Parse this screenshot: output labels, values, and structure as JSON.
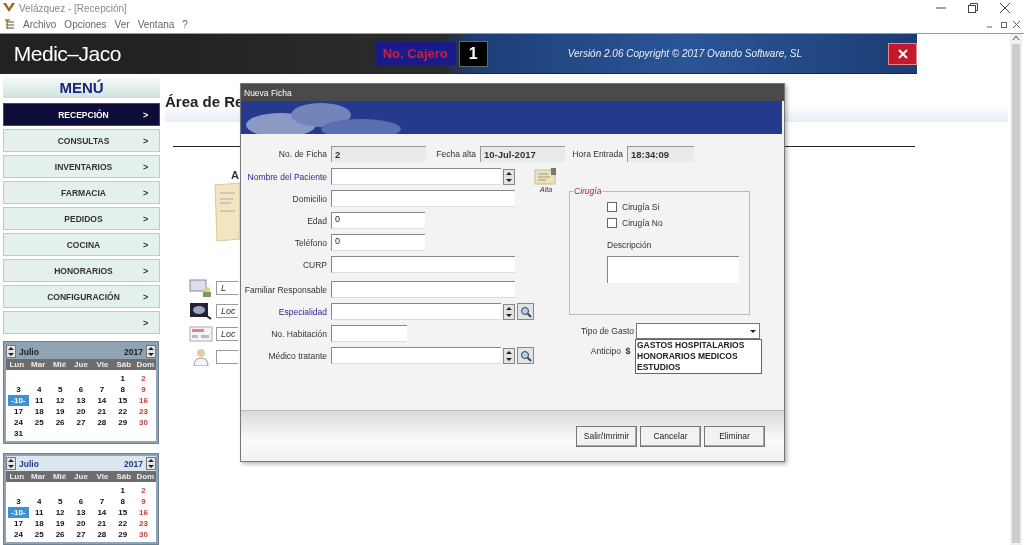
{
  "window": {
    "title": "Velázquez - [Recepción]"
  },
  "menu_bar": [
    "Archivo",
    "Opciones",
    "Ver",
    "Ventana",
    "?"
  ],
  "header": {
    "logo": "Medic–Jaco",
    "cashier_label": "No. Cajero",
    "cashier_number": "1",
    "version": "Versión 2.06 Copyright © 2017 Ovando Software, SL"
  },
  "sidebar": {
    "title": "MENÚ",
    "items": [
      {
        "label": "RECEPCIÓN",
        "arrow": ">",
        "selected": true
      },
      {
        "label": "CONSULTAS",
        "arrow": ">",
        "selected": false
      },
      {
        "label": "INVENTARIOS",
        "arrow": ">",
        "selected": false
      },
      {
        "label": "FARMACIA",
        "arrow": ">",
        "selected": false
      },
      {
        "label": "PEDIDOS",
        "arrow": ">",
        "selected": false
      },
      {
        "label": "COCINA",
        "arrow": ">",
        "selected": false
      },
      {
        "label": "HONORARIOS",
        "arrow": ">",
        "selected": false
      },
      {
        "label": "CONFIGURACIÓN",
        "arrow": ">",
        "selected": false
      },
      {
        "arrow": ">",
        "selected": false
      }
    ]
  },
  "calendars": [
    {
      "month": "Julio",
      "year": "2017",
      "weekdays": [
        "Lun",
        "Mar",
        "Mié",
        "Jue",
        "Vie",
        "Sáb",
        "Dom"
      ],
      "weeks": [
        [
          {
            "day": "1",
            "selected": false
          },
          {
            "day": "2",
            "selected": false
          }
        ],
        [
          {
            "day": "3",
            "selected": false
          },
          {
            "day": "4",
            "selected": false
          },
          {
            "day": "5",
            "selected": false
          },
          {
            "day": "6",
            "selected": false
          },
          {
            "day": "7",
            "selected": false
          },
          {
            "day": "8",
            "selected": false
          },
          {
            "day": "9",
            "selected": false
          }
        ],
        [
          {
            "day": "-10-",
            "selected": true
          },
          {
            "day": "11",
            "selected": false
          },
          {
            "day": "12",
            "selected": false
          },
          {
            "day": "13",
            "selected": false
          },
          {
            "day": "14",
            "selected": false
          },
          {
            "day": "15",
            "selected": false
          },
          {
            "day": "16",
            "selected": false
          }
        ],
        [
          {
            "day": "17",
            "selected": false
          },
          {
            "day": "18",
            "selected": false
          },
          {
            "day": "19",
            "selected": false
          },
          {
            "day": "20",
            "selected": false
          },
          {
            "day": "21",
            "selected": false
          },
          {
            "day": "22",
            "selected": false
          },
          {
            "day": "23",
            "selected": false
          }
        ],
        [
          {
            "day": "24",
            "selected": false
          },
          {
            "day": "25",
            "selected": false
          },
          {
            "day": "26",
            "selected": false
          },
          {
            "day": "27",
            "selected": false
          },
          {
            "day": "28",
            "selected": false
          },
          {
            "day": "29",
            "selected": false
          },
          {
            "day": "30",
            "selected": false
          }
        ],
        [
          {
            "day": "31",
            "selected": false
          }
        ]
      ]
    },
    {
      "month": "Julio",
      "year": "2017",
      "weekdays": [
        "Lun",
        "Mar",
        "Mié",
        "Jue",
        "Vie",
        "Sáb",
        "Dom"
      ],
      "weeks": [
        [
          {
            "day": "1",
            "selected": false
          },
          {
            "day": "2",
            "selected": false
          }
        ],
        [
          {
            "day": "3",
            "selected": false
          },
          {
            "day": "4",
            "selected": false
          },
          {
            "day": "5",
            "selected": false
          },
          {
            "day": "6",
            "selected": false
          },
          {
            "day": "7",
            "selected": false
          },
          {
            "day": "8",
            "selected": false
          },
          {
            "day": "9",
            "selected": false
          }
        ],
        [
          {
            "day": "-10-",
            "selected": true
          },
          {
            "day": "11",
            "selected": false
          },
          {
            "day": "12",
            "selected": false
          },
          {
            "day": "13",
            "selected": false
          },
          {
            "day": "14",
            "selected": false
          },
          {
            "day": "15",
            "selected": false
          },
          {
            "day": "16",
            "selected": false
          }
        ],
        [
          {
            "day": "17",
            "selected": false
          },
          {
            "day": "18",
            "selected": false
          },
          {
            "day": "19",
            "selected": false
          },
          {
            "day": "20",
            "selected": false
          },
          {
            "day": "21",
            "selected": false
          },
          {
            "day": "22",
            "selected": false
          },
          {
            "day": "23",
            "selected": false
          }
        ],
        [
          {
            "day": "24",
            "selected": false
          },
          {
            "day": "25",
            "selected": false
          },
          {
            "day": "26",
            "selected": false
          },
          {
            "day": "27",
            "selected": false
          },
          {
            "day": "28",
            "selected": false
          },
          {
            "day": "29",
            "selected": false
          },
          {
            "day": "30",
            "selected": false
          }
        ]
      ]
    }
  ],
  "main": {
    "title": "Área de Re",
    "subtitle": "A",
    "shortcuts": [
      {
        "kind": "card",
        "text": "L"
      },
      {
        "kind": "monitor",
        "text": "Loc"
      },
      {
        "kind": "form",
        "text": "Loc"
      },
      {
        "kind": "doctor"
      }
    ]
  },
  "dialog": {
    "title": "Nueva Ficha",
    "info": [
      {
        "label": "No. de Ficha",
        "value": "2"
      },
      {
        "label": "Fecha alta",
        "value": "10-Jul-2017"
      },
      {
        "label": "Hora Entrada",
        "value": "18:34:09"
      }
    ],
    "sections": [
      [
        {
          "label": "Nombre del Paciente",
          "kind": "spin",
          "linked": true
        },
        {
          "label": "Domicilio",
          "kind": "text",
          "linked": false
        },
        {
          "label": "Edad",
          "kind": "number",
          "linked": false,
          "value": "0"
        },
        {
          "label": "Teléfono",
          "kind": "number",
          "linked": false,
          "value": "0"
        },
        {
          "label": "CURP",
          "kind": "text",
          "linked": false
        }
      ],
      [
        {
          "label": "Familiar Responsable",
          "kind": "text",
          "linked": false
        },
        {
          "label": "Especialidad",
          "kind": "lookup",
          "linked": true
        },
        {
          "label": "No. Habitación",
          "kind": "short",
          "linked": false
        },
        {
          "label": "Médico tratante",
          "kind": "lookup",
          "linked": false
        }
      ]
    ],
    "alta": "Alta",
    "surgery": {
      "title": "Cirugía",
      "options": [
        {
          "label": "Cirugía Si",
          "checked": false
        },
        {
          "label": "Cirugía No",
          "checked": false
        }
      ],
      "description_label": "Descripción"
    },
    "expense": {
      "label": "Tipo de Gasto",
      "open": true,
      "options": [
        "GASTOS HOSPITALARIOS",
        "HONORARIOS MEDICOS",
        "ESTUDIOS"
      ]
    },
    "advance": {
      "label": "Anticipo",
      "currency": "$"
    },
    "buttons": [
      "Salir/Imrimir",
      "Cancelar",
      "Eliminar"
    ]
  }
}
